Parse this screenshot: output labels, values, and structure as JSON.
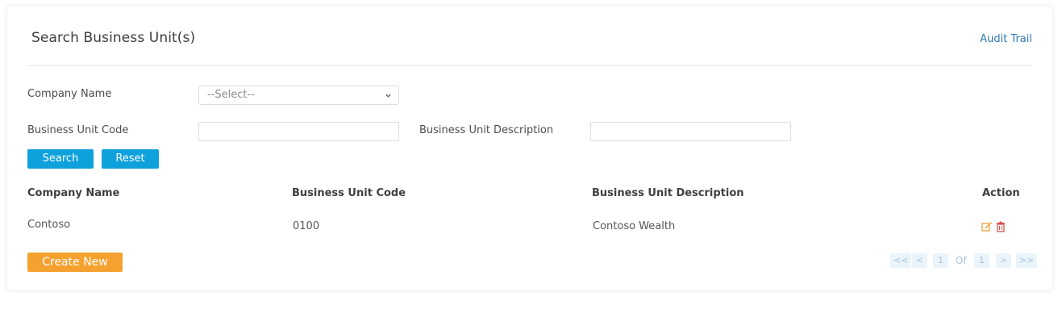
{
  "header": {
    "title": "Search Business Unit(s)",
    "audit_link": "Audit Trail"
  },
  "form": {
    "company_name_label": "Company Name",
    "company_select_value": "--Select--",
    "bu_code_label": "Business Unit Code",
    "bu_desc_label": "Business Unit Description",
    "search_label": "Search",
    "reset_label": "Reset"
  },
  "table": {
    "headers": [
      "Company Name",
      "Business Unit Code",
      "Business Unit Description",
      "Action"
    ],
    "rows": [
      {
        "company": "Contoso",
        "code": "0100",
        "description": "Contoso Wealth"
      }
    ]
  },
  "footer": {
    "create_label": "Create New",
    "pagination": {
      "first": "<<",
      "prev": "<",
      "current": "1",
      "of": "Of",
      "total": "1",
      "next": ">",
      "last": ">>"
    }
  },
  "colors": {
    "primary_button": "#0ea1dc",
    "create_button": "#f5a130",
    "link": "#2f79b8",
    "edit_icon": "#e9a23b",
    "delete_icon": "#d9534f"
  },
  "icons": [
    "chevron-down-icon",
    "edit-icon",
    "delete-icon"
  ]
}
